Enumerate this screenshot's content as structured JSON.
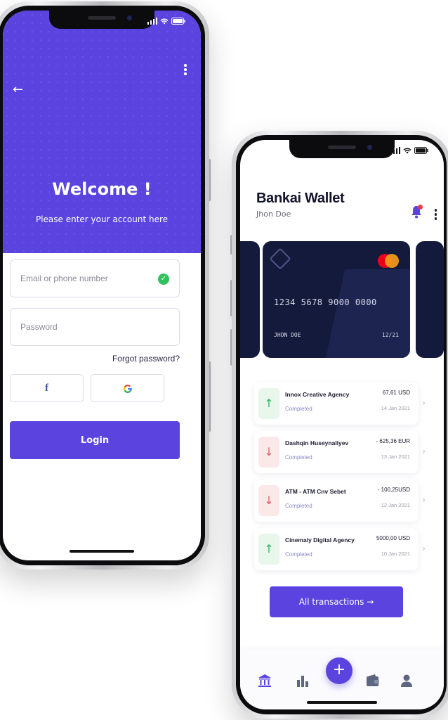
{
  "login_screen": {
    "title": "Welcome !",
    "subtitle": "Please enter your account here",
    "email_placeholder": "Email or phone number",
    "password_placeholder": "Password",
    "forgot_password": "Forgot password?",
    "facebook_label": "f",
    "google_label": "G",
    "login_button": "Login",
    "colors": {
      "primary": "#5a43df",
      "success": "#2ec15c"
    },
    "icons": [
      "back-arrow-icon",
      "kebab-menu-icon",
      "check-circle-icon",
      "facebook-icon",
      "google-icon"
    ]
  },
  "wallet_screen": {
    "app_title": "Bankai Wallet",
    "user_name": "Jhon Doe",
    "card": {
      "number": "1234 5678 9000 0000",
      "holder": "JHON DOE",
      "expiry": "12/21"
    },
    "transactions": [
      {
        "name": "Innox Creative Agency",
        "status": "Completed",
        "amount": "67,61 USD",
        "date": "14 Jan 2021",
        "direction": "up"
      },
      {
        "name": "Dashqin Huseynaliyev",
        "status": "Completed",
        "amount": "- 625,36 EUR",
        "date": "13 Jan 2021",
        "direction": "down"
      },
      {
        "name": "ATM - ATM Cnv Sebet",
        "status": "Completed",
        "amount": "- 100,25USD",
        "date": "12 Jan 2021",
        "direction": "down"
      },
      {
        "name": "Cinemaly Digital Agency",
        "status": "Completed",
        "amount": "5000,00 USD",
        "date": "10 Jan 2021",
        "direction": "up"
      }
    ],
    "all_transactions_button": "All transactions →",
    "fab_label": "+",
    "nav_items": [
      "bank-icon",
      "chart-icon",
      "wallet-icon",
      "user-icon"
    ],
    "colors": {
      "primary": "#5a43df",
      "card_bg": "#141a3b",
      "up": "#2eb85c",
      "down": "#e35d66",
      "notification": "#e43b4d"
    }
  }
}
